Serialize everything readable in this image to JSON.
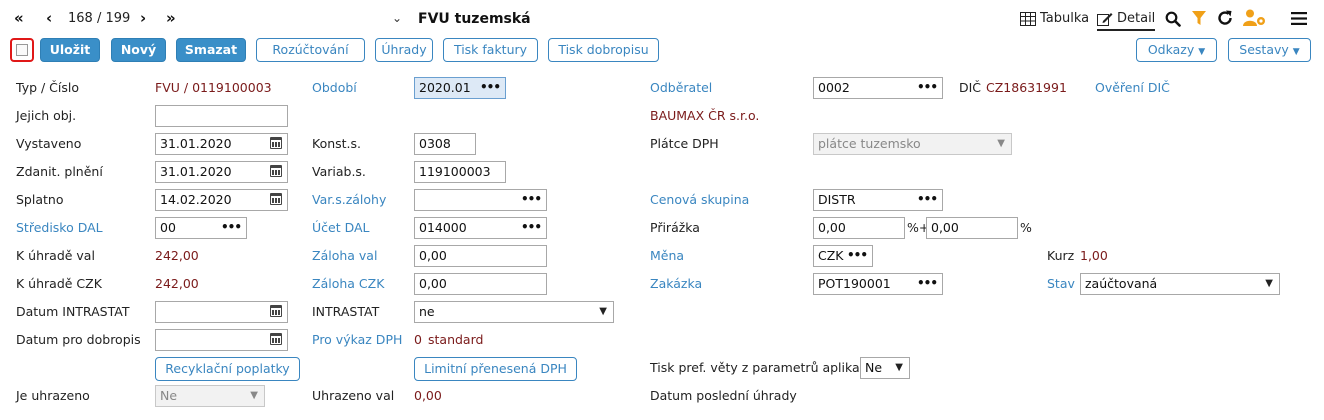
{
  "nav": {
    "first": "«",
    "prev": "‹",
    "record_current": "168",
    "record_sep": "/",
    "record_total": "199",
    "next": "›",
    "last": "»"
  },
  "title": {
    "chevron": "⌄",
    "label": "FVU tuzemská"
  },
  "toolbar_right": {
    "table_label": "Tabulka",
    "detail_label": "Detail"
  },
  "actions": {
    "save": "Uložit",
    "new": "Nový",
    "delete": "Smazat",
    "allocation": "Rozúčtování",
    "payments": "Úhrady",
    "print_invoice": "Tisk faktury",
    "print_credit": "Tisk dobropisu",
    "links": "Odkazy",
    "reports": "Sestavy"
  },
  "form": {
    "type_number_label": "Typ / Číslo",
    "type_value": "FVU",
    "number_sep": "/",
    "number_value": "0119100003",
    "period_label": "Období",
    "period_value": "2020.01",
    "customer_label": "Odběratel",
    "customer_value": "0002",
    "dic_label": "DIČ",
    "dic_value": "CZ18631991",
    "dic_verify": "Ověření DIČ",
    "their_order_label": "Jejich obj.",
    "their_order_value": "",
    "customer_name": "BAUMAX ČR s.r.o.",
    "issued_label": "Vystaveno",
    "issued_value": "31.01.2020",
    "const_label": "Konst.s.",
    "const_value": "0308",
    "vat_payer_label": "Plátce DPH",
    "vat_payer_value": "plátce tuzemsko",
    "taxable_label": "Zdanit. plnění",
    "taxable_value": "31.01.2020",
    "var_label": "Variab.s.",
    "var_value": "119100003",
    "due_label": "Splatno",
    "due_value": "14.02.2020",
    "var_adv_label": "Var.s.zálohy",
    "var_adv_value": "",
    "price_group_label": "Cenová skupina",
    "price_group_value": "DISTR",
    "center_label": "Středisko DAL",
    "center_value": "00",
    "account_label": "Účet DAL",
    "account_value": "014000",
    "surcharge_label": "Přirážka",
    "surcharge_value1": "0,00",
    "surcharge_mid": "%+",
    "surcharge_value2": "0,00",
    "surcharge_pct": "%",
    "pay_val_label": "K úhradě val",
    "pay_val_value": "242,00",
    "adv_val_label": "Záloha val",
    "adv_val_value": "0,00",
    "currency_label": "Měna",
    "currency_value": "CZK",
    "rate_label": "Kurz",
    "rate_value": "1,00",
    "pay_czk_label": "K úhradě CZK",
    "pay_czk_value": "242,00",
    "adv_czk_label": "Záloha CZK",
    "adv_czk_value": "0,00",
    "order_label": "Zakázka",
    "order_value": "POT190001",
    "state_label": "Stav",
    "state_value": "zaúčtovaná",
    "intrastat_date_label": "Datum INTRASTAT",
    "intrastat_date_value": "",
    "intrastat_label": "INTRASTAT",
    "intrastat_value": "ne",
    "credit_date_label": "Datum pro dobropis",
    "credit_date_value": "",
    "vat_report_label": "Pro výkaz DPH",
    "vat_report_value": "0",
    "vat_report_text": "standard",
    "recycle_btn": "Recyklační poplatky",
    "limited_vat_btn": "Limitní přenesená DPH",
    "print_pref_label": "Tisk pref. věty z parametrů aplikace",
    "print_pref_value": "Ne",
    "is_paid_label": "Je uhrazeno",
    "is_paid_value": "Ne",
    "paid_val_label": "Uhrazeno val",
    "paid_val_value": "0,00",
    "last_payment_label": "Datum poslední úhrady"
  }
}
